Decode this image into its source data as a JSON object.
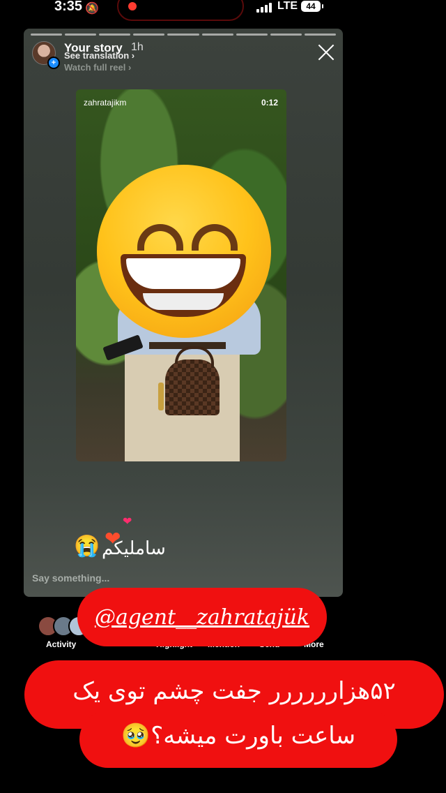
{
  "status_bar": {
    "time": "3:35",
    "silent_icon": "bell-slash-icon",
    "network": "LTE",
    "battery": "44"
  },
  "story": {
    "title": "Your story",
    "age": "1h",
    "see_translation": "See translation ›",
    "watch_full_reel": "Watch full reel ›",
    "video_username": "zahratajikm",
    "video_duration": "0:12",
    "caption": "ساملیکم",
    "reply_placeholder": "Say something..."
  },
  "toolbar": {
    "activity": "Activity",
    "highlight": "Highlight",
    "mention": "Mention",
    "send": "Send",
    "more": "More"
  },
  "overlay": {
    "handle": "@agent__zahratajük",
    "line1": "۵۲هزارررررر جفت چشم توی یک",
    "line2": "ساعت باورت میشه؟🥹"
  },
  "colors": {
    "overlay_red": "#f01010",
    "card_bg": "#3c423d",
    "accent_blue": "#1a8cff"
  }
}
